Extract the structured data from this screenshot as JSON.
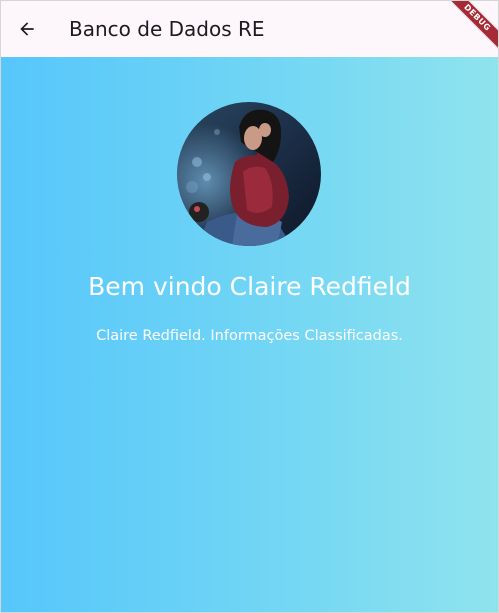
{
  "appbar": {
    "title": "Banco de Dados RE",
    "back_icon": "arrow-back-icon",
    "background": "#fdf7fc"
  },
  "debug_banner": {
    "label": "DEBUG",
    "color": "#a52a36"
  },
  "profile": {
    "avatar_icon": "profile-photo",
    "welcome": "Bem vindo Claire Redfield",
    "subtitle": "Claire Redfield. Informações Classificadas."
  },
  "colors": {
    "gradient_start": "#56c6fb",
    "gradient_end": "#8fe3ee",
    "text": "#ffffff"
  }
}
